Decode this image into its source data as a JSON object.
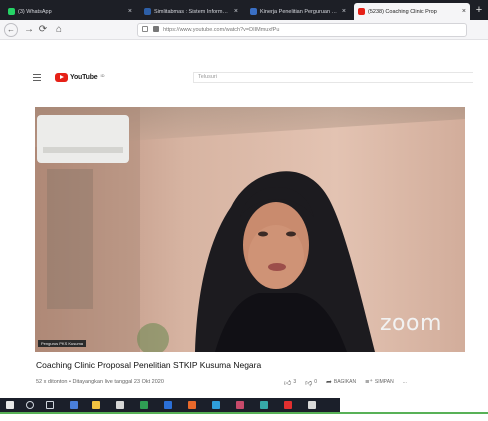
{
  "browser": {
    "tabs": [
      {
        "label": "(3) WhatsApp",
        "favicon_color": "#25d366"
      },
      {
        "label": "Simlitabmas : Sistem Informasi Pen",
        "favicon_color": "#2d5fa8"
      },
      {
        "label": "Kinerja Penelitian Perguruan Tinggi",
        "favicon_color": "#3a6fc4"
      },
      {
        "label": "(5238) Coaching Clinic Prop",
        "favicon_color": "#e62117"
      }
    ],
    "close_glyph": "×",
    "new_tab_glyph": "+",
    "url_host": "youtube.com",
    "url": "https://www.youtube.com/watch?v=DIIMmuxfPu"
  },
  "youtube": {
    "logo_text": "YouTube",
    "logo_region": "ID",
    "search_placeholder": "Telusuri"
  },
  "video": {
    "watermark": "zoom",
    "participant_name": "Pengurus PKS Kusuma",
    "title": "Coaching Clinic Proposal Penelitian STKIP Kusuma Negara",
    "meta": "52 x ditonton • Ditayangkan live tanggal 23 Okt 2020",
    "likes": "3",
    "dislikes": "0",
    "share_label": "BAGIKAN",
    "save_label": "SIMPAN",
    "more_label": "..."
  },
  "colors": {
    "youtube_red": "#e62117",
    "taskbar_accent_line": "#58b157",
    "tab_bar": "#1d1f26"
  }
}
